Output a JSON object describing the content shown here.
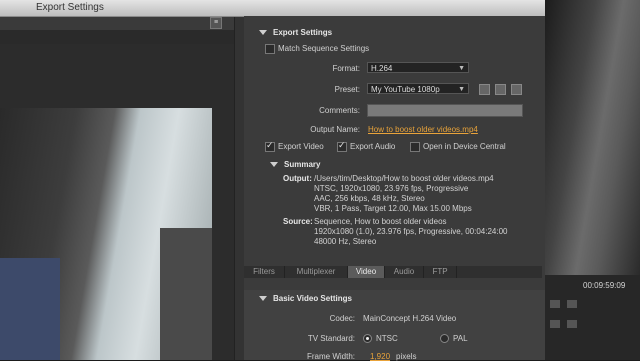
{
  "window": {
    "title": "Export Settings"
  },
  "panel_toggle": "≡",
  "export_settings": {
    "header": "Export Settings",
    "match_sequence_label": "Match Sequence Settings",
    "format_label": "Format:",
    "format_value": "H.264",
    "preset_label": "Preset:",
    "preset_value": "My YouTube 1080p",
    "comments_label": "Comments:",
    "comments_value": "",
    "output_name_label": "Output Name:",
    "output_name_value": "How to boost older videos.mp4",
    "export_video_label": "Export Video",
    "export_audio_label": "Export Audio",
    "open_device_label": "Open in Device Central"
  },
  "summary": {
    "header": "Summary",
    "output_label": "Output:",
    "output_lines": [
      "/Users/tim/Desktop/How to boost older videos.mp4",
      "NTSC, 1920x1080, 23.976 fps, Progressive",
      "AAC, 256 kbps, 48 kHz, Stereo",
      "VBR, 1 Pass, Target 12.00, Max 15.00 Mbps"
    ],
    "source_label": "Source:",
    "source_lines": [
      "Sequence, How to boost older videos",
      "1920x1080 (1.0), 23.976 fps, Progressive, 00:04:24:00",
      "48000 Hz, Stereo"
    ]
  },
  "tabs": [
    "Filters",
    "Multiplexer",
    "Video",
    "Audio",
    "FTP"
  ],
  "active_tab": "Video",
  "basic_video": {
    "header": "Basic Video Settings",
    "codec_label": "Codec:",
    "codec_value": "MainConcept H.264 Video",
    "tv_standard_label": "TV Standard:",
    "tv_standard_ntsc": "NTSC",
    "tv_standard_pal": "PAL",
    "frame_width_label": "Frame Width:",
    "frame_width_value": "1,920",
    "frame_width_unit": "pixels"
  },
  "timecode": "00:09:59:09",
  "icons": {
    "save_preset": "save-preset-icon",
    "import_preset": "import-preset-icon",
    "delete_preset": "delete-preset-icon"
  }
}
